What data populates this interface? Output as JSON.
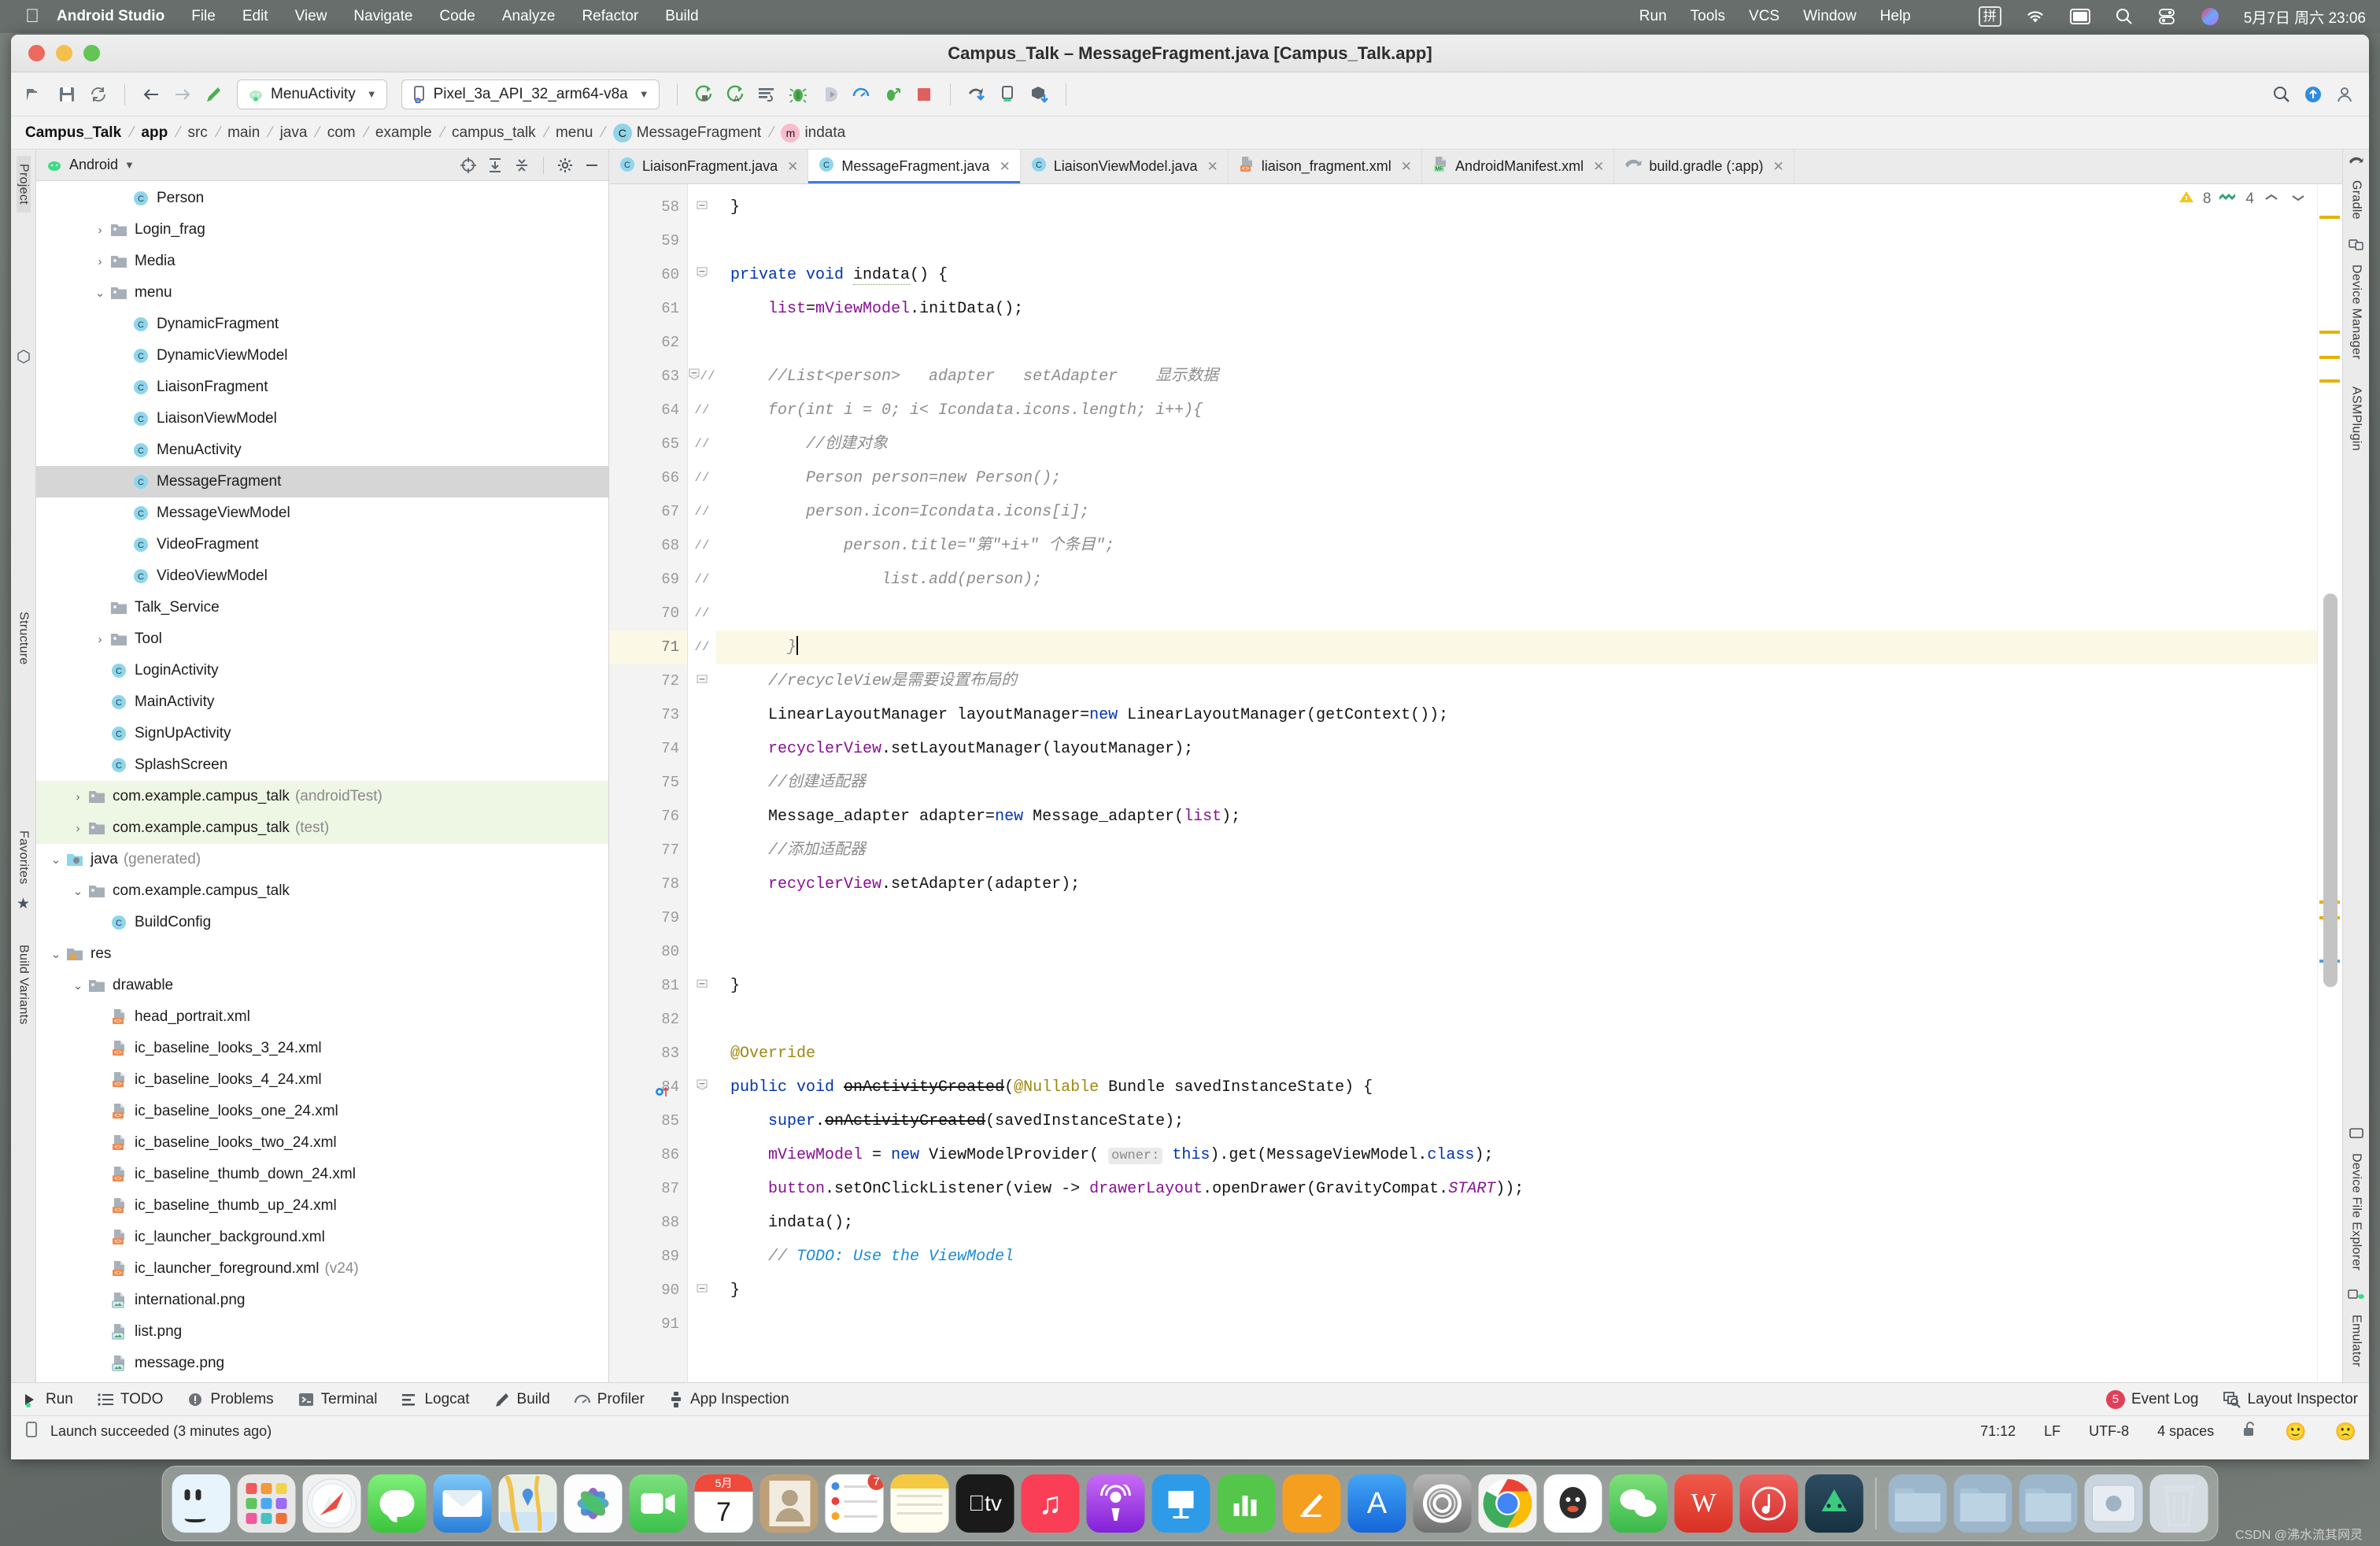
{
  "mac_menu": {
    "apple_icon": "apple-icon",
    "app_name": "Android Studio",
    "items": [
      "File",
      "Edit",
      "View",
      "Navigate",
      "Code",
      "Analyze",
      "Refactor",
      "Build"
    ],
    "right_items": [
      "Run",
      "Tools",
      "VCS",
      "Window",
      "Help"
    ],
    "ime_label": "拼",
    "status_icons": [
      "wifi-icon",
      "display-icon",
      "spotlight-search-icon",
      "control-center-icon",
      "siri-icon"
    ],
    "clock": "5月7日 周六  23:06"
  },
  "window": {
    "title": "Campus_Talk – MessageFragment.java [Campus_Talk.app]"
  },
  "toolbar": {
    "left_icons": [
      "open-folder-icon",
      "save-all-icon",
      "sync-icon"
    ],
    "nav_icons": [
      "back-arrow-icon",
      "forward-arrow-icon",
      "build-hammer-icon"
    ],
    "run_config": "MenuActivity",
    "device": "Pixel_3a_API_32_arm64-v8a",
    "run_icons": [
      "run-icon",
      "run-with-coverage-icon",
      "apply-changes-icon",
      "debug-icon",
      "attach-debugger-icon",
      "profiler-icon",
      "profile-run-icon",
      "stop-icon"
    ],
    "right_icons": [
      "gradle-sync-icon",
      "avd-manager-icon",
      "sdk-manager-icon"
    ],
    "far_right_icons": [
      "search-everywhere-icon",
      "upload-icon",
      "account-icon"
    ]
  },
  "breadcrumbs": [
    {
      "label": "Campus_Talk",
      "bold": true,
      "icon": ""
    },
    {
      "label": "app",
      "bold": true,
      "icon": ""
    },
    {
      "label": "src",
      "bold": false,
      "icon": ""
    },
    {
      "label": "main",
      "bold": false,
      "icon": ""
    },
    {
      "label": "java",
      "bold": false,
      "icon": ""
    },
    {
      "label": "com",
      "bold": false,
      "icon": ""
    },
    {
      "label": "example",
      "bold": false,
      "icon": ""
    },
    {
      "label": "campus_talk",
      "bold": false,
      "icon": ""
    },
    {
      "label": "menu",
      "bold": false,
      "icon": ""
    },
    {
      "label": "MessageFragment",
      "bold": false,
      "icon": "class-icon"
    },
    {
      "label": "indata",
      "bold": false,
      "icon": "method-icon"
    }
  ],
  "left_strip": {
    "tabs": [
      "Project",
      "Structure",
      "Favorites",
      "Build Variants"
    ],
    "selected": "Project",
    "bottom_icons": [
      "resource-manager-icon"
    ]
  },
  "project_panel": {
    "title": "Android",
    "dropdown_icon": "chevron-down-icon",
    "header_icons": [
      "select-opened-file-icon",
      "expand-all-icon",
      "collapse-all-icon",
      "settings-gear-icon",
      "hide-icon"
    ],
    "tree": [
      {
        "label": "Person",
        "depth": 3,
        "arrow": "",
        "icon": "class-icon",
        "state": ""
      },
      {
        "label": "Login_frag",
        "depth": 2,
        "arrow": "collapsed",
        "icon": "folder-icon",
        "state": ""
      },
      {
        "label": "Media",
        "depth": 2,
        "arrow": "collapsed",
        "icon": "folder-icon",
        "state": ""
      },
      {
        "label": "menu",
        "depth": 2,
        "arrow": "expanded",
        "icon": "folder-icon",
        "state": ""
      },
      {
        "label": "DynamicFragment",
        "depth": 3,
        "arrow": "",
        "icon": "class-icon",
        "state": ""
      },
      {
        "label": "DynamicViewModel",
        "depth": 3,
        "arrow": "",
        "icon": "class-icon",
        "state": ""
      },
      {
        "label": "LiaisonFragment",
        "depth": 3,
        "arrow": "",
        "icon": "class-icon",
        "state": ""
      },
      {
        "label": "LiaisonViewModel",
        "depth": 3,
        "arrow": "",
        "icon": "class-icon",
        "state": ""
      },
      {
        "label": "MenuActivity",
        "depth": 3,
        "arrow": "",
        "icon": "class-icon",
        "state": ""
      },
      {
        "label": "MessageFragment",
        "depth": 3,
        "arrow": "",
        "icon": "class-icon",
        "state": "selected"
      },
      {
        "label": "MessageViewModel",
        "depth": 3,
        "arrow": "",
        "icon": "class-icon",
        "state": ""
      },
      {
        "label": "VideoFragment",
        "depth": 3,
        "arrow": "",
        "icon": "class-icon",
        "state": ""
      },
      {
        "label": "VideoViewModel",
        "depth": 3,
        "arrow": "",
        "icon": "class-icon",
        "state": ""
      },
      {
        "label": "Talk_Service",
        "depth": 2,
        "arrow": "",
        "icon": "folder-icon",
        "state": ""
      },
      {
        "label": "Tool",
        "depth": 2,
        "arrow": "collapsed",
        "icon": "folder-icon",
        "state": ""
      },
      {
        "label": "LoginActivity",
        "depth": 2,
        "arrow": "",
        "icon": "class-icon",
        "state": ""
      },
      {
        "label": "MainActivity",
        "depth": 2,
        "arrow": "",
        "icon": "class-icon",
        "state": ""
      },
      {
        "label": "SignUpActivity",
        "depth": 2,
        "arrow": "",
        "icon": "class-icon",
        "state": ""
      },
      {
        "label": "SplashScreen",
        "depth": 2,
        "arrow": "",
        "icon": "class-icon",
        "state": ""
      },
      {
        "label": "com.example.campus_talk",
        "suffix": "(androidTest)",
        "depth": 1,
        "arrow": "collapsed",
        "icon": "folder-icon",
        "state": "green"
      },
      {
        "label": "com.example.campus_talk",
        "suffix": "(test)",
        "depth": 1,
        "arrow": "collapsed",
        "icon": "folder-icon",
        "state": "green"
      },
      {
        "label": "java",
        "suffix": "(generated)",
        "depth": 0,
        "arrow": "expanded",
        "icon": "gen-folder-icon",
        "state": ""
      },
      {
        "label": "com.example.campus_talk",
        "depth": 1,
        "arrow": "expanded",
        "icon": "folder-icon",
        "state": ""
      },
      {
        "label": "BuildConfig",
        "depth": 2,
        "arrow": "",
        "icon": "class-icon",
        "state": ""
      },
      {
        "label": "res",
        "depth": 0,
        "arrow": "expanded",
        "icon": "res-folder-icon",
        "state": ""
      },
      {
        "label": "drawable",
        "depth": 1,
        "arrow": "expanded",
        "icon": "folder-icon",
        "state": ""
      },
      {
        "label": "head_portrait.xml",
        "depth": 2,
        "arrow": "",
        "icon": "xml-icon",
        "state": ""
      },
      {
        "label": "ic_baseline_looks_3_24.xml",
        "depth": 2,
        "arrow": "",
        "icon": "xml-icon",
        "state": ""
      },
      {
        "label": "ic_baseline_looks_4_24.xml",
        "depth": 2,
        "arrow": "",
        "icon": "xml-icon",
        "state": ""
      },
      {
        "label": "ic_baseline_looks_one_24.xml",
        "depth": 2,
        "arrow": "",
        "icon": "xml-icon",
        "state": ""
      },
      {
        "label": "ic_baseline_looks_two_24.xml",
        "depth": 2,
        "arrow": "",
        "icon": "xml-icon",
        "state": ""
      },
      {
        "label": "ic_baseline_thumb_down_24.xml",
        "depth": 2,
        "arrow": "",
        "icon": "xml-icon",
        "state": ""
      },
      {
        "label": "ic_baseline_thumb_up_24.xml",
        "depth": 2,
        "arrow": "",
        "icon": "xml-icon",
        "state": ""
      },
      {
        "label": "ic_launcher_background.xml",
        "depth": 2,
        "arrow": "",
        "icon": "xml-icon",
        "state": ""
      },
      {
        "label": "ic_launcher_foreground.xml",
        "suffix": "(v24)",
        "depth": 2,
        "arrow": "",
        "icon": "xml-icon",
        "state": ""
      },
      {
        "label": "international.png",
        "depth": 2,
        "arrow": "",
        "icon": "png-icon",
        "state": ""
      },
      {
        "label": "list.png",
        "depth": 2,
        "arrow": "",
        "icon": "png-icon",
        "state": ""
      },
      {
        "label": "message.png",
        "depth": 2,
        "arrow": "",
        "icon": "png-icon",
        "state": ""
      }
    ]
  },
  "editor_tabs": [
    {
      "label": "LiaisonFragment.java",
      "icon": "java-class-icon",
      "active": false
    },
    {
      "label": "MessageFragment.java",
      "icon": "java-class-icon",
      "active": true
    },
    {
      "label": "LiaisonViewModel.java",
      "icon": "java-class-icon",
      "active": false
    },
    {
      "label": "liaison_fragment.xml",
      "icon": "layout-xml-icon",
      "active": false
    },
    {
      "label": "AndroidManifest.xml",
      "icon": "manifest-xml-icon",
      "active": false
    },
    {
      "label": "build.gradle (:app)",
      "icon": "gradle-icon",
      "active": false
    }
  ],
  "inspections": {
    "warning_icon": "warning-triangle-icon",
    "warning_count": "8",
    "weak_warning_icon": "weak-warning-icon",
    "weak_warning_count": "4",
    "prev_icon": "chevron-up-icon",
    "next_icon": "chevron-down-icon"
  },
  "code": {
    "first_line": 58,
    "current_line": 71,
    "lines": [
      {
        "n": 58,
        "fold": "end",
        "gutterComment": false,
        "text": "}"
      },
      {
        "n": 59,
        "fold": "",
        "gutterComment": false,
        "text": ""
      },
      {
        "n": 60,
        "fold": "start",
        "gutterComment": false,
        "text": "private void indata() {"
      },
      {
        "n": 61,
        "fold": "",
        "gutterComment": false,
        "text": "    list=mViewModel.initData();"
      },
      {
        "n": 62,
        "fold": "",
        "gutterComment": false,
        "text": ""
      },
      {
        "n": 63,
        "fold": "start",
        "gutterComment": true,
        "text": "    //List<person>   adapter   setAdapter    显示数据"
      },
      {
        "n": 64,
        "fold": "",
        "gutterComment": true,
        "text": "    for(int i = 0; i< Icondata.icons.length; i++){"
      },
      {
        "n": 65,
        "fold": "",
        "gutterComment": true,
        "text": "        //创建对象"
      },
      {
        "n": 66,
        "fold": "",
        "gutterComment": true,
        "text": "        Person person=new Person();"
      },
      {
        "n": 67,
        "fold": "",
        "gutterComment": true,
        "text": "        person.icon=Icondata.icons[i];"
      },
      {
        "n": 68,
        "fold": "",
        "gutterComment": true,
        "text": "            person.title=\"第\"+i+\" 个条目\";"
      },
      {
        "n": 69,
        "fold": "",
        "gutterComment": true,
        "text": "                list.add(person);"
      },
      {
        "n": 70,
        "fold": "",
        "gutterComment": true,
        "text": ""
      },
      {
        "n": 71,
        "fold": "",
        "gutterComment": true,
        "text": "      }"
      },
      {
        "n": 72,
        "fold": "end",
        "gutterComment": false,
        "text": "    //recycleView是需要设置布局的"
      },
      {
        "n": 73,
        "fold": "",
        "gutterComment": false,
        "text": "    LinearLayoutManager layoutManager=new LinearLayoutManager(getContext());"
      },
      {
        "n": 74,
        "fold": "",
        "gutterComment": false,
        "text": "    recyclerView.setLayoutManager(layoutManager);"
      },
      {
        "n": 75,
        "fold": "",
        "gutterComment": false,
        "text": "    //创建适配器"
      },
      {
        "n": 76,
        "fold": "",
        "gutterComment": false,
        "text": "    Message_adapter adapter=new Message_adapter(list);"
      },
      {
        "n": 77,
        "fold": "",
        "gutterComment": false,
        "text": "    //添加适配器"
      },
      {
        "n": 78,
        "fold": "",
        "gutterComment": false,
        "text": "    recyclerView.setAdapter(adapter);"
      },
      {
        "n": 79,
        "fold": "",
        "gutterComment": false,
        "text": ""
      },
      {
        "n": 80,
        "fold": "",
        "gutterComment": false,
        "text": ""
      },
      {
        "n": 81,
        "fold": "end",
        "gutterComment": false,
        "text": "}"
      },
      {
        "n": 82,
        "fold": "",
        "gutterComment": false,
        "text": ""
      },
      {
        "n": 83,
        "fold": "",
        "gutterComment": false,
        "text": "@Override"
      },
      {
        "n": 84,
        "fold": "start",
        "gutterComment": false,
        "text": "public void onActivityCreated(@Nullable Bundle savedInstanceState) {"
      },
      {
        "n": 85,
        "fold": "",
        "gutterComment": false,
        "text": "    super.onActivityCreated(savedInstanceState);"
      },
      {
        "n": 86,
        "fold": "",
        "gutterComment": false,
        "text": "    mViewModel = new ViewModelProvider( owner: this).get(MessageViewModel.class);"
      },
      {
        "n": 87,
        "fold": "",
        "gutterComment": false,
        "text": "    button.setOnClickListener(view -> drawerLayout.openDrawer(GravityCompat.START));"
      },
      {
        "n": 88,
        "fold": "",
        "gutterComment": false,
        "text": "    indata();"
      },
      {
        "n": 89,
        "fold": "",
        "gutterComment": false,
        "text": "    // TODO: Use the ViewModel"
      },
      {
        "n": 90,
        "fold": "end",
        "gutterComment": false,
        "text": "}"
      },
      {
        "n": 91,
        "fold": "",
        "gutterComment": false,
        "text": ""
      }
    ]
  },
  "right_strip": {
    "tabs": [
      "Gradle",
      "Device Manager",
      "ASMPlugin",
      "Device File Explorer",
      "Emulator"
    ]
  },
  "tool_window_bar": {
    "items": [
      {
        "label": "Run",
        "icon": "run-icon"
      },
      {
        "label": "TODO",
        "icon": "todo-icon"
      },
      {
        "label": "Problems",
        "icon": "problems-icon"
      },
      {
        "label": "Terminal",
        "icon": "terminal-icon"
      },
      {
        "label": "Logcat",
        "icon": "logcat-icon"
      },
      {
        "label": "Build",
        "icon": "build-icon"
      },
      {
        "label": "Profiler",
        "icon": "profiler-icon"
      },
      {
        "label": "App Inspection",
        "icon": "app-inspection-icon"
      }
    ],
    "right": [
      {
        "label": "Event Log",
        "icon": "event-log-icon",
        "badge": "5"
      },
      {
        "label": "Layout Inspector",
        "icon": "layout-inspector-icon",
        "badge": ""
      }
    ]
  },
  "status_bar": {
    "icon": "device-icon",
    "message": "Launch succeeded (3 minutes ago)",
    "caret_position": "71:12",
    "line_separator": "LF",
    "encoding": "UTF-8",
    "indent": "4 spaces",
    "lock_icon": "unlocked-icon",
    "faces": [
      "happy-face-icon",
      "sad-face-icon"
    ]
  },
  "dock": {
    "items": [
      {
        "name": "finder",
        "glyph": "",
        "color": "#3f9fe0",
        "running": true
      },
      {
        "name": "launchpad",
        "glyph": "",
        "color": "#e8e8e8",
        "running": false
      },
      {
        "name": "safari",
        "glyph": "",
        "color": "#f0f0f0",
        "running": true
      },
      {
        "name": "messages",
        "glyph": "",
        "color": "#5ed25b",
        "running": false
      },
      {
        "name": "mail",
        "glyph": "",
        "color": "#2e8ce8",
        "running": false
      },
      {
        "name": "maps",
        "glyph": "",
        "color": "#e9e9e9",
        "running": true
      },
      {
        "name": "photos",
        "glyph": "",
        "color": "#fdfdfd",
        "running": false
      },
      {
        "name": "facetime",
        "glyph": "",
        "color": "#54d162",
        "running": false
      },
      {
        "name": "calendar",
        "glyph": "7",
        "sub": "5月",
        "color": "#ffffff",
        "running": false
      },
      {
        "name": "contacts",
        "glyph": "",
        "color": "#c0a078",
        "running": false
      },
      {
        "name": "reminders",
        "glyph": "",
        "color": "#ffffff",
        "running": false,
        "badge": "7"
      },
      {
        "name": "notes",
        "glyph": "",
        "color": "#fdf5cf",
        "running": true
      },
      {
        "name": "appletv",
        "glyph": "tv",
        "color": "#1a1a1a",
        "running": false
      },
      {
        "name": "music",
        "glyph": "♫",
        "color": "#fa3e56",
        "running": false
      },
      {
        "name": "podcasts",
        "glyph": "◎",
        "color": "#9b3ae0",
        "running": false
      },
      {
        "name": "keynote",
        "glyph": "",
        "color": "#2e9be8",
        "running": false
      },
      {
        "name": "numbers",
        "glyph": "",
        "color": "#54c64a",
        "running": false
      },
      {
        "name": "pages",
        "glyph": "✎",
        "color": "#f59f20",
        "running": false
      },
      {
        "name": "app-store",
        "glyph": "A",
        "color": "#1f8ae8",
        "running": false
      },
      {
        "name": "system-preferences",
        "glyph": "⚙",
        "color": "#8f8f8f",
        "running": true
      },
      {
        "name": "chrome",
        "glyph": "",
        "color": "#f2f2f2",
        "running": true
      },
      {
        "name": "qq",
        "glyph": "",
        "color": "#ffffff",
        "running": true
      },
      {
        "name": "wechat",
        "glyph": "",
        "color": "#5ccb5f",
        "running": true
      },
      {
        "name": "wps",
        "glyph": "W",
        "color": "#e8453c",
        "running": true
      },
      {
        "name": "netease-music",
        "glyph": "",
        "color": "#e8453c",
        "running": true
      },
      {
        "name": "android-studio",
        "glyph": "",
        "color": "#2b4a60",
        "running": true
      },
      {
        "name": "sep",
        "glyph": "",
        "color": "",
        "running": false
      },
      {
        "name": "folder-downloads",
        "glyph": "",
        "color": "#9cb6cc",
        "running": false
      },
      {
        "name": "folder-documents",
        "glyph": "",
        "color": "#9cb6cc",
        "running": false
      },
      {
        "name": "folder-pictures",
        "glyph": "",
        "color": "#9cb6cc",
        "running": false
      },
      {
        "name": "screenshot",
        "glyph": "",
        "color": "#c9d4de",
        "running": false
      },
      {
        "name": "trash",
        "glyph": "",
        "color": "#d6dde2",
        "running": false
      }
    ]
  },
  "watermark": "CSDN @沸水流其网灵"
}
